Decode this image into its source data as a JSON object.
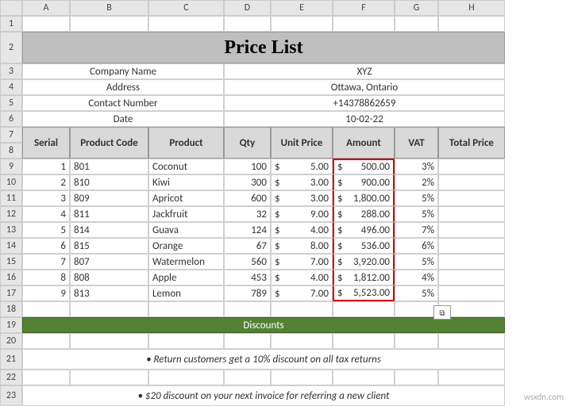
{
  "columns": [
    "A",
    "B",
    "C",
    "D",
    "E",
    "F",
    "G",
    "H"
  ],
  "rows": [
    "1",
    "2",
    "3",
    "4",
    "5",
    "6",
    "7",
    "8",
    "9",
    "10",
    "11",
    "12",
    "13",
    "14",
    "15",
    "16",
    "17",
    "18",
    "19",
    "20",
    "21",
    "22",
    "23"
  ],
  "title": "Price List",
  "info": {
    "company_label": "Company Name",
    "company_value": "XYZ",
    "address_label": "Address",
    "address_value": "Ottawa, Ontario",
    "contact_label": "Contact Number",
    "contact_value": "+14378862659",
    "date_label": "Date",
    "date_value": "10-02-22"
  },
  "headers": {
    "serial": "Serial",
    "product_code": "Product Code",
    "product": "Product",
    "qty": "Qty",
    "unit_price": "Unit Price",
    "amount": "Amount",
    "vat": "VAT",
    "total_price": "Total Price"
  },
  "data_rows": [
    {
      "serial": "1",
      "code": "801",
      "product": "Coconut",
      "qty": "100",
      "unit_price": "5.00",
      "amount": "500.00",
      "vat": "3%"
    },
    {
      "serial": "2",
      "code": "810",
      "product": "Kiwi",
      "qty": "300",
      "unit_price": "3.00",
      "amount": "900.00",
      "vat": "2%"
    },
    {
      "serial": "3",
      "code": "809",
      "product": "Apricot",
      "qty": "600",
      "unit_price": "3.00",
      "amount": "1,800.00",
      "vat": "5%"
    },
    {
      "serial": "4",
      "code": "811",
      "product": "Jackfruit",
      "qty": "32",
      "unit_price": "9.00",
      "amount": "288.00",
      "vat": "5%"
    },
    {
      "serial": "5",
      "code": "814",
      "product": "Guava",
      "qty": "124",
      "unit_price": "4.00",
      "amount": "496.00",
      "vat": "7%"
    },
    {
      "serial": "6",
      "code": "815",
      "product": "Orange",
      "qty": "67",
      "unit_price": "8.00",
      "amount": "536.00",
      "vat": "6%"
    },
    {
      "serial": "7",
      "code": "807",
      "product": "Watermelon",
      "qty": "560",
      "unit_price": "7.00",
      "amount": "3,920.00",
      "vat": "5%"
    },
    {
      "serial": "8",
      "code": "808",
      "product": "Apple",
      "qty": "453",
      "unit_price": "4.00",
      "amount": "1,812.00",
      "vat": "4%"
    },
    {
      "serial": "9",
      "code": "813",
      "product": "Lemon",
      "qty": "789",
      "unit_price": "7.00",
      "amount": "5,523.00",
      "vat": "5%"
    }
  ],
  "discounts_header": "Discounts",
  "discount_lines": [
    "• Return customers get a 10% discount on all tax returns",
    "• $20 discount on your next invoice for referring a new client"
  ],
  "watermark": "wsxdn.com",
  "paste_icon": "⧉"
}
